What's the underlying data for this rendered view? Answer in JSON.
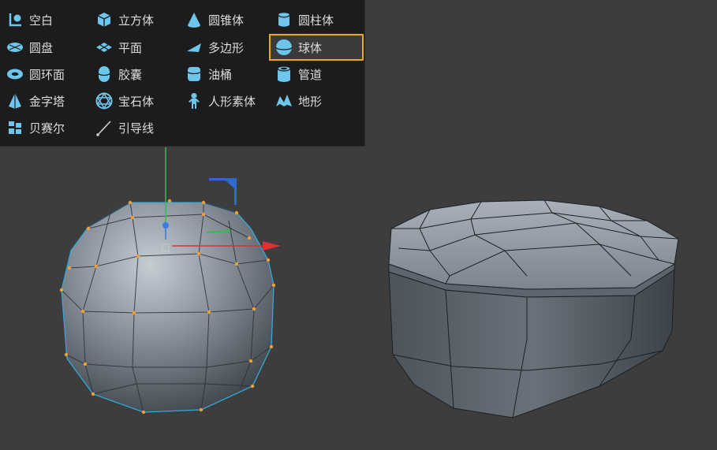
{
  "menu": {
    "items": [
      {
        "label": "空白",
        "icon": "null-object-icon"
      },
      {
        "label": "立方体",
        "icon": "cube-icon"
      },
      {
        "label": "圆锥体",
        "icon": "cone-icon"
      },
      {
        "label": "圆柱体",
        "icon": "cylinder-icon"
      },
      {
        "label": "圆盘",
        "icon": "disc-icon"
      },
      {
        "label": "平面",
        "icon": "plane-icon"
      },
      {
        "label": "多边形",
        "icon": "polygon-icon"
      },
      {
        "label": "球体",
        "icon": "sphere-icon",
        "selected": true
      },
      {
        "label": "圆环面",
        "icon": "torus-icon"
      },
      {
        "label": "胶囊",
        "icon": "capsule-icon"
      },
      {
        "label": "油桶",
        "icon": "oil-tank-icon"
      },
      {
        "label": "管道",
        "icon": "tube-icon"
      },
      {
        "label": "金字塔",
        "icon": "pyramid-icon"
      },
      {
        "label": "宝石体",
        "icon": "gem-icon"
      },
      {
        "label": "人形素体",
        "icon": "figure-icon"
      },
      {
        "label": "地形",
        "icon": "landscape-icon"
      },
      {
        "label": "贝赛尔",
        "icon": "bezier-icon"
      },
      {
        "label": "引导线",
        "icon": "guide-icon"
      }
    ]
  },
  "colors": {
    "menu_bg": "#1c1c1c",
    "icon": "#6fc6ec",
    "selection_border": "#e9a822",
    "viewport_bg": "#3d3d3d",
    "wire": "#35a8d8",
    "point": "#f0a030",
    "axis_x": "#e03030",
    "axis_y": "#2ec04a",
    "axis_z": "#3a7ce8"
  }
}
